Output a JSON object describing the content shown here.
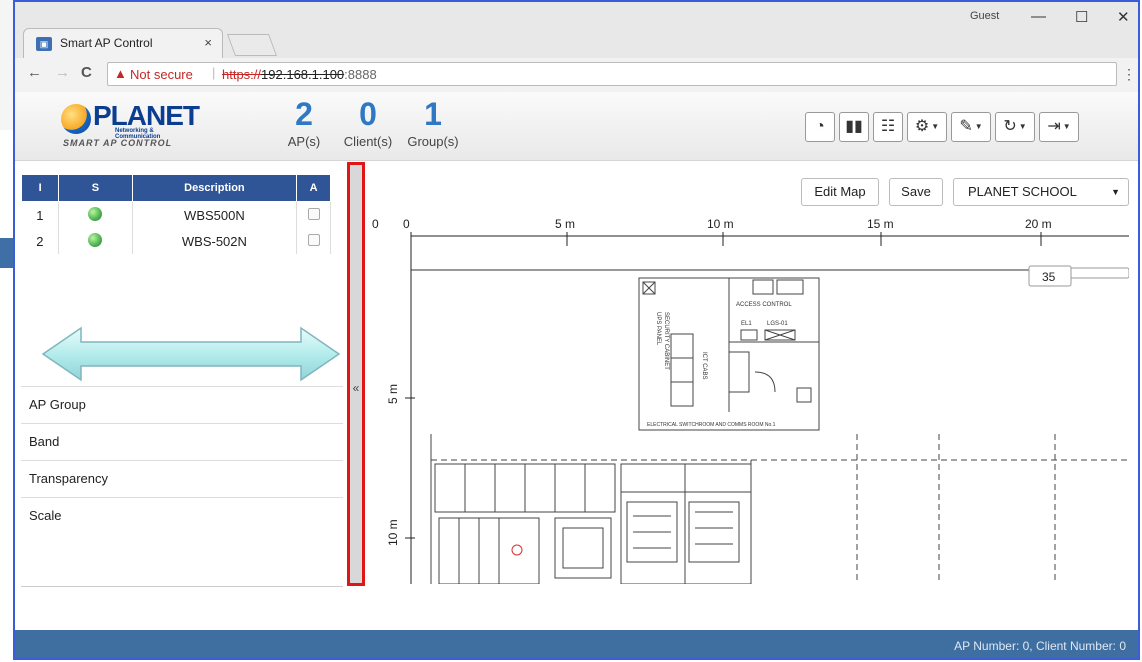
{
  "browser": {
    "tab_title": "Smart AP Control",
    "tab_close": "×",
    "user_label": "Guest",
    "minimize": "—",
    "maximize": "☐",
    "close": "✕",
    "back": "←",
    "forward": "→",
    "reload": "C",
    "security_icon": "warning-triangle",
    "security_label": "Not secure",
    "url_scheme": "https://",
    "url_host": "192.168.1.100",
    "url_port": ":8888",
    "menu": "⋮"
  },
  "header": {
    "logo_brand": "PLANET",
    "logo_tagline": "Networking & Communication",
    "logo_sub": "SMART AP CONTROL",
    "stats": [
      {
        "value": "2",
        "label": "AP(s)"
      },
      {
        "value": "0",
        "label": "Client(s)"
      },
      {
        "value": "1",
        "label": "Group(s)"
      }
    ],
    "tool_icons": [
      "dashboard-icon",
      "bar-chart-icon",
      "network-icon",
      "gear-icon",
      "wrench-icon",
      "refresh-icon",
      "logout-icon"
    ]
  },
  "ap_table": {
    "columns": [
      "I",
      "S",
      "Description",
      "A"
    ],
    "rows": [
      {
        "index": "1",
        "status": "online",
        "description": "WBS500N"
      },
      {
        "index": "2",
        "status": "online",
        "description": "WBS-502N"
      }
    ]
  },
  "properties": [
    "AP Group",
    "Band",
    "Transparency",
    "Scale"
  ],
  "splitter": {
    "collapse": "«"
  },
  "map": {
    "edit_label": "Edit Map",
    "save_label": "Save",
    "selected_map": "PLANET SCHOOL",
    "scale_value": "35",
    "corner_label": "0",
    "x_ticks": [
      "0",
      "5 m",
      "10 m",
      "15 m",
      "20 m"
    ],
    "y_ticks": [
      "5 m",
      "10 m"
    ],
    "room_labels": [
      "ELECTRICAL SWITCHROOM AND COMMS ROOM No.1",
      "ACCESS CONTROL",
      "EL1",
      "LGS-01",
      "ICT CABS",
      "SECURITY CABINET",
      "UPS PANEL"
    ]
  },
  "status": {
    "text": "AP Number: 0, Client Number: 0"
  }
}
